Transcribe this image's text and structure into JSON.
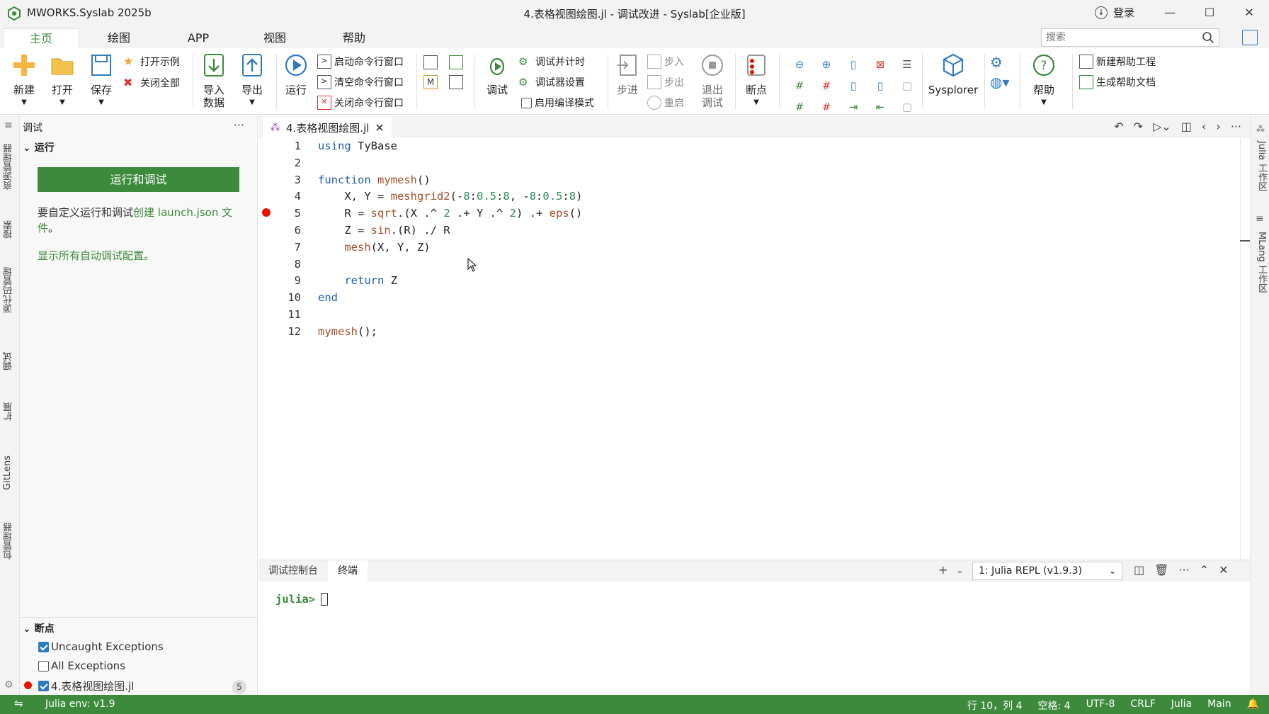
{
  "titlebar": {
    "app_name": "MWORKS.Syslab 2025b",
    "title": "4.表格视图绘图.jl - 调试改进 - Syslab[企业版]",
    "login": "登录",
    "minimize": "—",
    "maximize": "☐",
    "close": "✕"
  },
  "menubar": {
    "tabs": [
      "主页",
      "绘图",
      "APP",
      "视图",
      "帮助"
    ],
    "active": "主页",
    "search_placeholder": "搜索"
  },
  "ribbon": {
    "new": "新建",
    "open": "打开",
    "save": "保存",
    "open_examples": "打开示例",
    "close_all": "关闭全部",
    "import_line1": "导入",
    "import_line2": "数据",
    "export": "导出",
    "run": "运行",
    "start_cmd": "启动命令行窗口",
    "clear_cmd": "清空命令行窗口",
    "close_cmd": "关闭命令行窗口",
    "debug": "调试",
    "debug_timer": "调试并计时",
    "debugger_settings": "调试器设置",
    "compile_mode": "启用编译模式",
    "step": "步进",
    "step_in": "步入",
    "step_out": "步出",
    "restart": "重启",
    "exit_debug_line1": "退出",
    "exit_debug_line2": "调试",
    "breakpoint": "断点",
    "sysplorer": "Sysplorer",
    "help": "帮助",
    "new_help_project": "新建帮助工程",
    "gen_help_doc": "生成帮助文档"
  },
  "activity": {
    "explorer": "资源管理器",
    "search": "搜索",
    "scm": "源代码管理",
    "debug": "调试",
    "extensions": "扩展",
    "gitlens": "GitLens",
    "packages": "包管理器"
  },
  "sidebar": {
    "title": "调试",
    "more": "···",
    "run_section": "运行",
    "run_button": "运行和调试",
    "custom_text_1": "要自定义运行和调试",
    "custom_link": "创建 launch.json 文件",
    "custom_text_2": "。",
    "show_all": "显示所有自动调试配置。",
    "breakpoints_section": "断点",
    "breakpoints": [
      {
        "label": "Uncaught Exceptions",
        "checked": true
      },
      {
        "label": "All Exceptions",
        "checked": false
      },
      {
        "label": "4.表格视图绘图.jl",
        "checked": true,
        "count": "5"
      }
    ]
  },
  "editor": {
    "tab": "4.表格视图绘图.jl",
    "lines": [
      {
        "n": "1",
        "code": "using TyBase"
      },
      {
        "n": "2",
        "code": ""
      },
      {
        "n": "3",
        "code": "function mymesh()"
      },
      {
        "n": "4",
        "code": "    X, Y = meshgrid2(-8:0.5:8, -8:0.5:8)"
      },
      {
        "n": "5",
        "code": "    R = sqrt.(X .^ 2 .+ Y .^ 2) .+ eps()"
      },
      {
        "n": "6",
        "code": "    Z = sin.(R) ./ R"
      },
      {
        "n": "7",
        "code": "    mesh(X, Y, Z)"
      },
      {
        "n": "8",
        "code": ""
      },
      {
        "n": "9",
        "code": "    return Z"
      },
      {
        "n": "10",
        "code": "end"
      },
      {
        "n": "11",
        "code": ""
      },
      {
        "n": "12",
        "code": "mymesh();"
      }
    ]
  },
  "rightbar": {
    "julia_ws": "Julia 工作区",
    "mlang_ws": "MLang 工作区"
  },
  "panel": {
    "tabs": [
      "调试控制台",
      "终端"
    ],
    "active": "终端",
    "repl": "1: Julia REPL (v1.9.3)",
    "prompt": "julia>"
  },
  "statusbar": {
    "env": "Julia env: v1.9",
    "position": "行 10，列 4",
    "spaces": "空格: 4",
    "encoding": "UTF-8",
    "eol": "CRLF",
    "lang": "Julia",
    "branch": "Main"
  },
  "colors": {
    "accent": "#3d8a3d",
    "blue": "#2e7bbf",
    "breakpoint": "#e51400"
  }
}
